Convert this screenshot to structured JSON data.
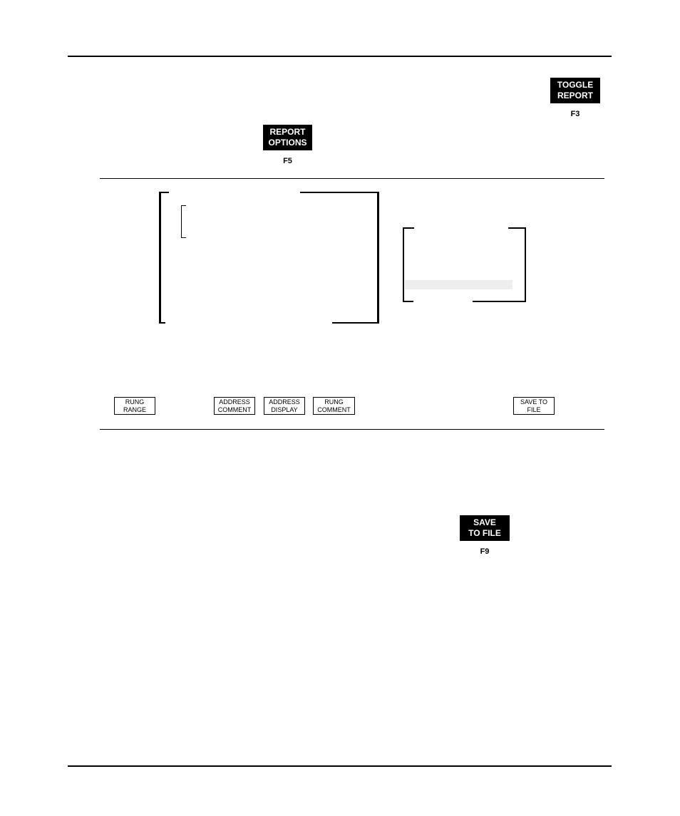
{
  "keys": {
    "toggle_report": {
      "line1": "TOGGLE",
      "line2": "REPORT",
      "fkey": "F3"
    },
    "report_options": {
      "line1": "REPORT",
      "line2": "OPTIONS",
      "fkey": "F5"
    },
    "save_to_file": {
      "line1": "SAVE",
      "line2": "TO FILE",
      "fkey": "F9"
    }
  },
  "softkeys": [
    {
      "line1": "RUNG",
      "line2": "RANGE"
    },
    {
      "line1": "ADDRESS",
      "line2": "COMMENT"
    },
    {
      "line1": "ADDRESS",
      "line2": "DISPLAY"
    },
    {
      "line1": "RUNG",
      "line2": "COMMENT"
    },
    {
      "line1": "SAVE TO",
      "line2": "FILE"
    }
  ],
  "colors": {
    "keycap_bg": "#000000",
    "keycap_text": "#ffffff",
    "highlight_bar": "#eeeeee"
  }
}
